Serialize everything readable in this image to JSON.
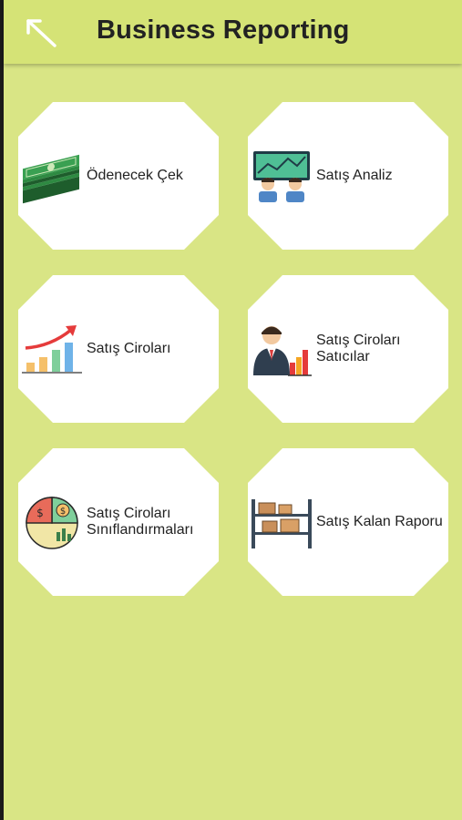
{
  "app_bar": {
    "title": "Business Reporting",
    "back_icon": "arrow-up-left-icon"
  },
  "colors": {
    "background": "#d9e585",
    "app_bar": "#d5e376",
    "tile": "#ffffff",
    "text": "#222222"
  },
  "tiles": [
    {
      "label": "Ödenecek Çek",
      "icon": "money-stack-icon"
    },
    {
      "label": "Satış Analiz",
      "icon": "team-analytics-icon"
    },
    {
      "label": "Satış Ciroları",
      "icon": "growth-chart-icon"
    },
    {
      "label": "Satış Ciroları Satıcılar",
      "icon": "salesperson-chart-icon"
    },
    {
      "label": "Satış Ciroları Sınıflandırmaları",
      "icon": "money-pie-icon"
    },
    {
      "label": "Satış Kalan Raporu",
      "icon": "warehouse-shelf-icon"
    }
  ]
}
